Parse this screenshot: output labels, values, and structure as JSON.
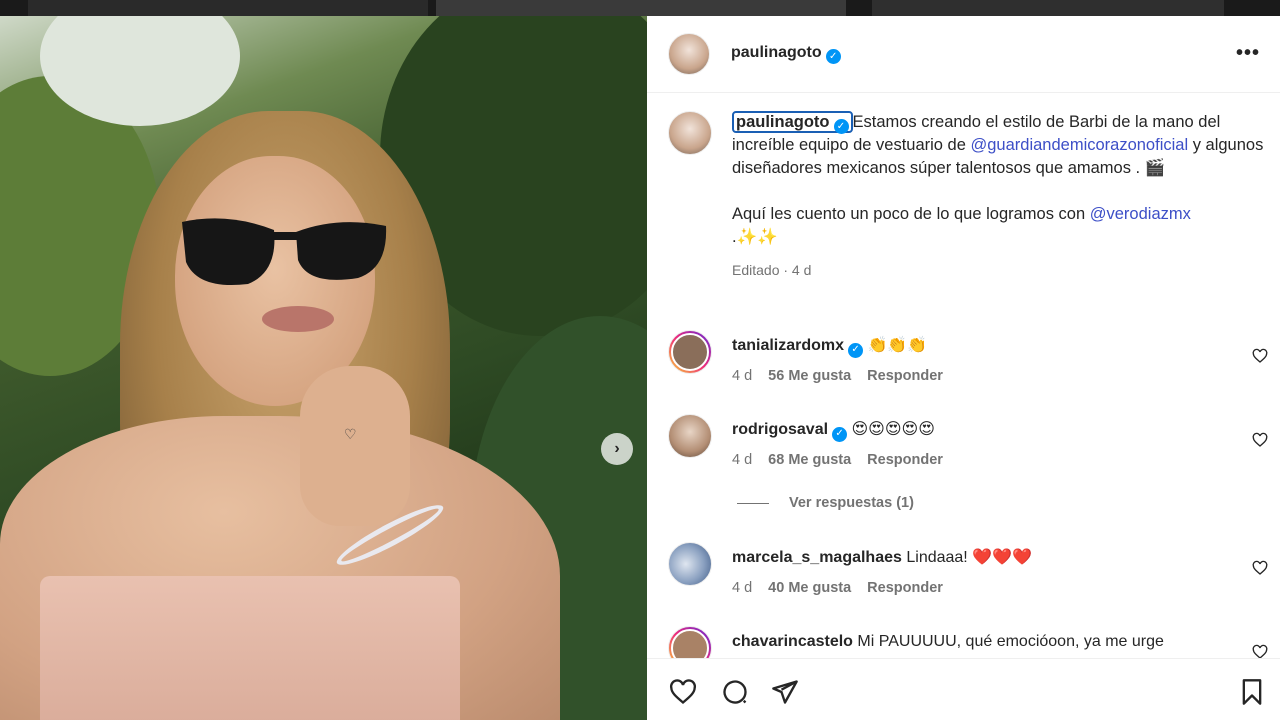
{
  "post": {
    "author": "paulinagoto",
    "more_icon": "•••"
  },
  "caption": {
    "username": "paulinagoto",
    "text_part1": "Estamos creando el estilo de Barbi de la mano del increíble equipo de vestuario de ",
    "mention1": "@guardiandemicorazonoficial",
    "text_part2": " y algunos diseñadores mexicanos súper talentosos que amamos . 🎬",
    "text_part3": "Aquí les cuento un poco de lo que logramos con ",
    "mention2": "@verodiazmx",
    "text_part4": " .✨✨",
    "meta": "Editado · 4 d"
  },
  "comments": [
    {
      "user": "tanializardomx",
      "verified": true,
      "text": "👏👏👏",
      "time": "4 d",
      "likes": "56 Me gusta",
      "reply": "Responder"
    },
    {
      "user": "rodrigosaval",
      "verified": true,
      "text": "😍😍😍😍😍",
      "time": "4 d",
      "likes": "68 Me gusta",
      "reply": "Responder"
    },
    {
      "user": "marcela_s_magalhaes",
      "verified": false,
      "text": "Lindaaa! ❤️❤️❤️",
      "time": "4 d",
      "likes": "40 Me gusta",
      "reply": "Responder"
    },
    {
      "user": "chavarincastelo",
      "verified": false,
      "text": "Mi PAUUUUU, qué emocióoon, ya me urge",
      "time": "",
      "likes": "",
      "reply": ""
    }
  ],
  "replies_label": "Ver respuestas (1)",
  "colors": {
    "link": "#3d4fc7",
    "verified": "#0095f6",
    "muted": "#737373"
  },
  "icons": [
    "heart-icon",
    "comment-icon",
    "share-icon",
    "bookmark-icon",
    "next-arrow-icon"
  ]
}
